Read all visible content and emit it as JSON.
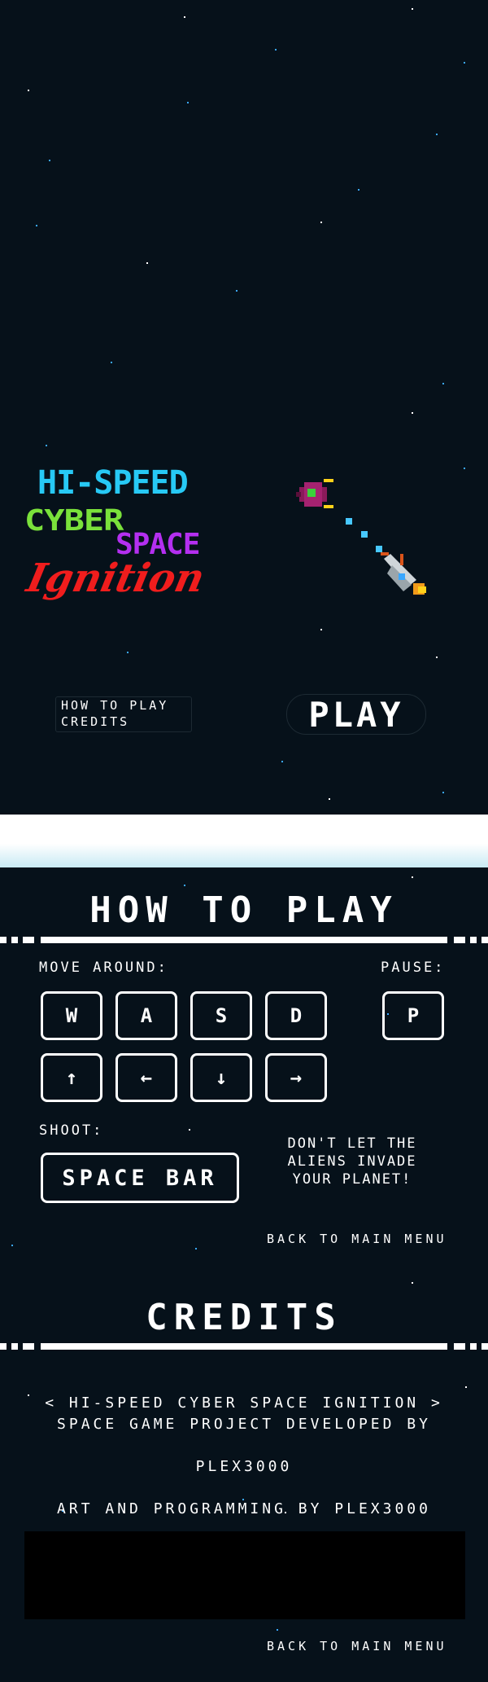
{
  "title_logo": {
    "line1": "HI-SPEED",
    "line2": "CYBER",
    "line3": "SPACE",
    "line4": "Ignition",
    "colors": {
      "line1": "#27c9f5",
      "line2": "#7ae13b",
      "line3": "#b42ff0",
      "line4": "#f01d1d"
    }
  },
  "main_menu": {
    "how_to_play": "HOW TO PLAY",
    "credits": "CREDITS",
    "play": "PLAY"
  },
  "how_to_play": {
    "title": "HOW TO PLAY",
    "move_label": "MOVE AROUND:",
    "pause_label": "PAUSE:",
    "keys_letters": [
      "W",
      "A",
      "S",
      "D"
    ],
    "keys_arrows": [
      "↑",
      "←",
      "↓",
      "→"
    ],
    "pause_key": "P",
    "shoot_label": "SHOOT:",
    "shoot_key": "SPACE BAR",
    "hint_lines": [
      "DON'T LET THE",
      "ALIENS INVADE",
      "YOUR PLANET!"
    ],
    "back": "BACK TO MAIN MENU"
  },
  "credits": {
    "title": "CREDITS",
    "line1": "< HI-SPEED CYBER SPACE IGNITION >",
    "line2": "SPACE GAME PROJECT DEVELOPED BY",
    "line3": "PLEX3000",
    "line4": "ART AND PROGRAMMING BY PLEX3000",
    "back": "BACK TO MAIN MENU"
  }
}
